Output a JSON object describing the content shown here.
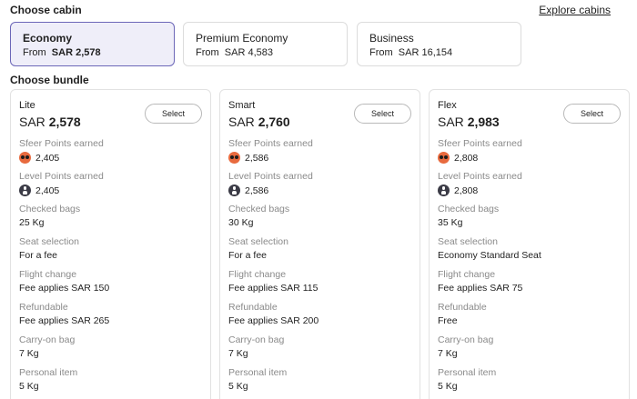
{
  "header": {
    "cabin_title": "Choose cabin",
    "explore_link": "Explore cabins",
    "bundle_title": "Choose bundle"
  },
  "cabins": [
    {
      "name": "Economy",
      "from": "From",
      "price": "SAR 2,578",
      "selected": true
    },
    {
      "name": "Premium Economy",
      "from": "From",
      "price": "SAR 4,583",
      "selected": false
    },
    {
      "name": "Business",
      "from": "From",
      "price": "SAR 16,154",
      "selected": false
    }
  ],
  "icons": {
    "sfeer": "sfeer-points-icon",
    "level": "level-points-icon"
  },
  "colors": {
    "accent": "#6c67b8",
    "selected_bg": "#efeef9",
    "sfeer_icon": "#e86a3e",
    "level_icon": "#3b3b46"
  },
  "bundles": [
    {
      "name": "Lite",
      "currency": "SAR",
      "amount": "2,578",
      "select_label": "Select",
      "features": [
        {
          "label": "Sfeer Points earned",
          "value": "2,405",
          "icon": "sfeer"
        },
        {
          "label": "Level Points earned",
          "value": "2,405",
          "icon": "level"
        },
        {
          "label": "Checked bags",
          "value": "25 Kg"
        },
        {
          "label": "Seat selection",
          "value": "For a fee"
        },
        {
          "label": "Flight change",
          "value": "Fee applies SAR 150"
        },
        {
          "label": "Refundable",
          "value": "Fee applies SAR 265"
        },
        {
          "label": "Carry-on bag",
          "value": "7 Kg"
        },
        {
          "label": "Personal item",
          "value": "5 Kg"
        }
      ]
    },
    {
      "name": "Smart",
      "currency": "SAR",
      "amount": "2,760",
      "select_label": "Select",
      "features": [
        {
          "label": "Sfeer Points earned",
          "value": "2,586",
          "icon": "sfeer"
        },
        {
          "label": "Level Points earned",
          "value": "2,586",
          "icon": "level"
        },
        {
          "label": "Checked bags",
          "value": "30 Kg"
        },
        {
          "label": "Seat selection",
          "value": "For a fee"
        },
        {
          "label": "Flight change",
          "value": "Fee applies SAR 115"
        },
        {
          "label": "Refundable",
          "value": "Fee applies SAR 200"
        },
        {
          "label": "Carry-on bag",
          "value": "7 Kg"
        },
        {
          "label": "Personal item",
          "value": "5 Kg"
        }
      ]
    },
    {
      "name": "Flex",
      "currency": "SAR",
      "amount": "2,983",
      "select_label": "Select",
      "features": [
        {
          "label": "Sfeer Points earned",
          "value": "2,808",
          "icon": "sfeer"
        },
        {
          "label": "Level Points earned",
          "value": "2,808",
          "icon": "level"
        },
        {
          "label": "Checked bags",
          "value": "35 Kg"
        },
        {
          "label": "Seat selection",
          "value": "Economy Standard Seat"
        },
        {
          "label": "Flight change",
          "value": "Fee applies SAR 75"
        },
        {
          "label": "Refundable",
          "value": "Free"
        },
        {
          "label": "Carry-on bag",
          "value": "7 Kg"
        },
        {
          "label": "Personal item",
          "value": "5 Kg"
        }
      ]
    }
  ]
}
